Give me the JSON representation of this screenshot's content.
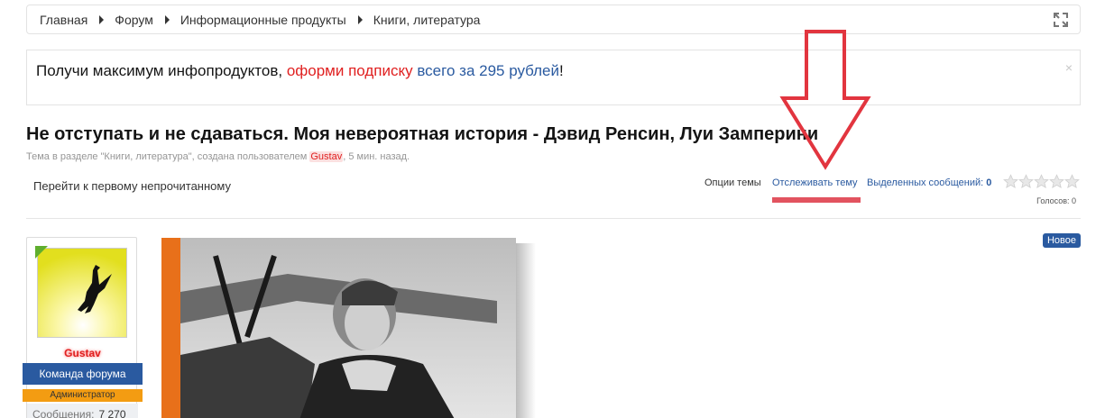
{
  "breadcrumb": {
    "items": [
      "Главная",
      "Форум",
      "Информационные продукты",
      "Книги, литература"
    ]
  },
  "notice": {
    "part1": "Получи максимум инфопродуктов, ",
    "link1": "оформи подписку",
    "part2": " ",
    "link2": "всего за 295 рублей",
    "part3": "!",
    "close": "×"
  },
  "thread": {
    "title": "Не отступать и не сдаваться. Моя невероятная история - Дэвид Ренсин, Луи Замперини",
    "meta_prefix": "Тема в разделе \"Книги, литература\", создана пользователем ",
    "meta_author": "Gustav",
    "meta_suffix": ", 5 мин. назад."
  },
  "toolbar": {
    "first_unread": "Перейти к первому непрочитанному",
    "thread_options": "Опции темы",
    "watch_thread": "Отслеживать тему",
    "selected_label": "Выделенных сообщений: ",
    "selected_count": "0",
    "votes": "Голосов: 0",
    "rating": 0
  },
  "post": {
    "user_name": "Gustav",
    "user_team": "Команда форума",
    "user_role": "Администратор",
    "stats_label": "Сообщения:",
    "stats_value": "7 270",
    "badge": "Новое"
  },
  "colors": {
    "accent_blue": "#2a5aa0",
    "alert_red": "#e02020",
    "role_orange": "#f39c12",
    "annotation_red": "#e2535f"
  }
}
